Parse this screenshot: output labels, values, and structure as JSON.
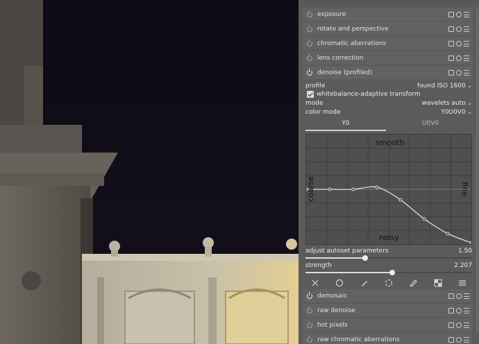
{
  "modules_top": [
    {
      "name": "exposure",
      "enabled": false
    },
    {
      "name": "rotate and perspective",
      "enabled": false
    },
    {
      "name": "chromatic aberrations",
      "enabled": false
    },
    {
      "name": "lens correction",
      "enabled": false
    }
  ],
  "expanded_module": {
    "name": "denoise (profiled)",
    "enabled": true,
    "profile": {
      "label": "profile",
      "value": "found ISO 1600"
    },
    "wb_adaptive": {
      "label": "whitebalance-adaptive transform",
      "checked": true
    },
    "mode": {
      "label": "mode",
      "value": "wavelets auto"
    },
    "color_mode": {
      "label": "color mode",
      "value": "Y0U0V0"
    },
    "tabs": [
      {
        "label": "Y0",
        "active": true
      },
      {
        "label": "U0V0",
        "active": false
      }
    ],
    "graph": {
      "top_label": "smooth",
      "bottom_label": "noisy",
      "left_label": "coarse",
      "right_label": "fine",
      "points": [
        0.5,
        0.5,
        0.5,
        0.48,
        0.6,
        0.78,
        0.92,
        1.02
      ],
      "curve_color": "#e8e8e8",
      "reference_color": "#b36a2a"
    },
    "adjust_autoset": {
      "label": "adjust autoset parameters",
      "value": "1.50",
      "fraction": 0.36
    },
    "strength": {
      "label": "strength",
      "value": "2.207",
      "fraction": 0.52
    }
  },
  "modules_bottom": [
    {
      "name": "demosaic",
      "enabled": true
    },
    {
      "name": "raw denoise",
      "enabled": false
    },
    {
      "name": "hot pixels",
      "enabled": false
    },
    {
      "name": "raw chromatic aberrations",
      "enabled": false
    }
  ],
  "toolbar_icons": [
    "close-icon",
    "circle-icon",
    "pencil-icon",
    "eyedropper-icon",
    "brush-icon",
    "checker-icon",
    "menu-icon"
  ],
  "colors": {
    "panel_bg": "#5b5b5b",
    "header_bg": "#626262",
    "accent": "#dedede"
  }
}
